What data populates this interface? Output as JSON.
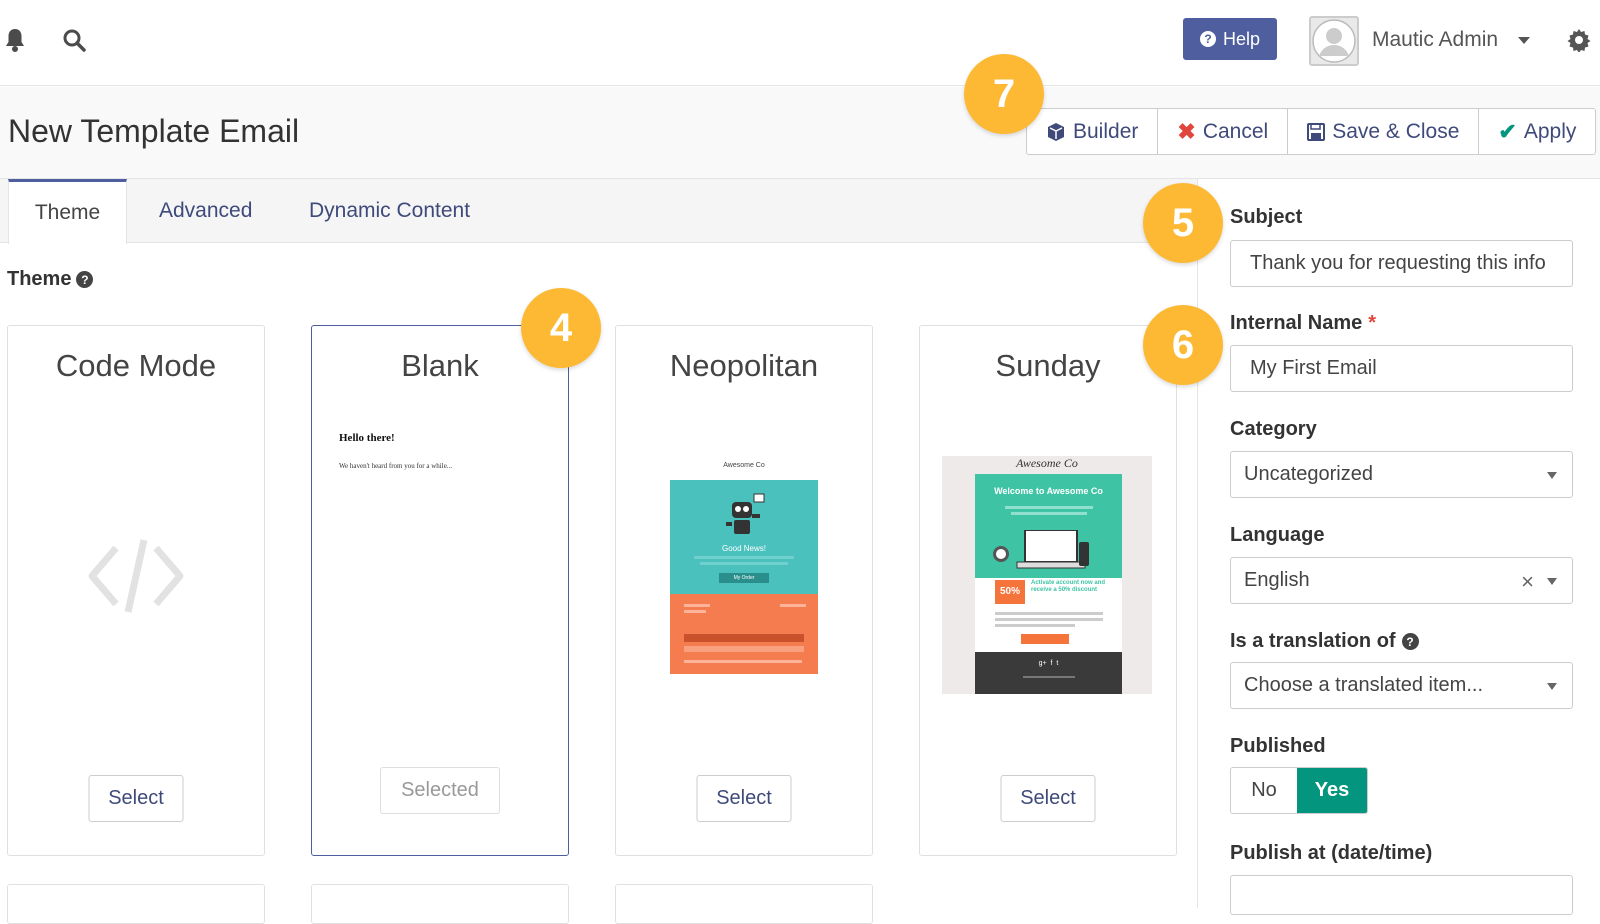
{
  "topbar": {
    "bell_icon": "bell-icon",
    "search_icon": "search-icon",
    "help_label": "Help",
    "user_name": "Mautic Admin",
    "settings_icon": "gear-icon"
  },
  "header": {
    "title": "New Template Email",
    "buttons": {
      "builder": "Builder",
      "cancel": "Cancel",
      "save_close": "Save & Close",
      "apply": "Apply"
    }
  },
  "tabs": [
    "Theme",
    "Advanced",
    "Dynamic Content"
  ],
  "theme_section": {
    "label": "Theme",
    "cards": [
      {
        "title": "Code Mode",
        "button": "Select",
        "selected": false
      },
      {
        "title": "Blank",
        "button": "Selected",
        "selected": true
      },
      {
        "title": "Neopolitan",
        "button": "Select",
        "selected": false
      },
      {
        "title": "Sunday",
        "button": "Select",
        "selected": false
      }
    ],
    "blank_preview": {
      "heading": "Hello there!",
      "body": "We haven't heard from you for a while..."
    },
    "neopolitan_preview": {
      "brand": "Awesome Co",
      "headline": "Good News!",
      "cta": "My Order"
    },
    "sunday_preview": {
      "brand": "Awesome Co",
      "headline": "Welcome to Awesome Co",
      "promo": "50%",
      "promo_text": "Activate account now and receive a 50% discount"
    }
  },
  "sidebar": {
    "subject_label": "Subject",
    "subject_value": "Thank you for requesting this info",
    "internal_name_label": "Internal Name",
    "required_mark": "*",
    "internal_name_value": "My First Email",
    "category_label": "Category",
    "category_value": "Uncategorized",
    "language_label": "Language",
    "language_value": "English",
    "translation_label": "Is a translation of",
    "translation_placeholder": "Choose a translated item...",
    "published_label": "Published",
    "published_no": "No",
    "published_yes": "Yes",
    "publish_at_label": "Publish at (date/time)"
  },
  "callouts": [
    "4",
    "5",
    "6",
    "7"
  ],
  "colors": {
    "primary": "#4e5e9e",
    "success": "#04957e",
    "callout": "#fdb933",
    "danger": "#e0463c"
  }
}
